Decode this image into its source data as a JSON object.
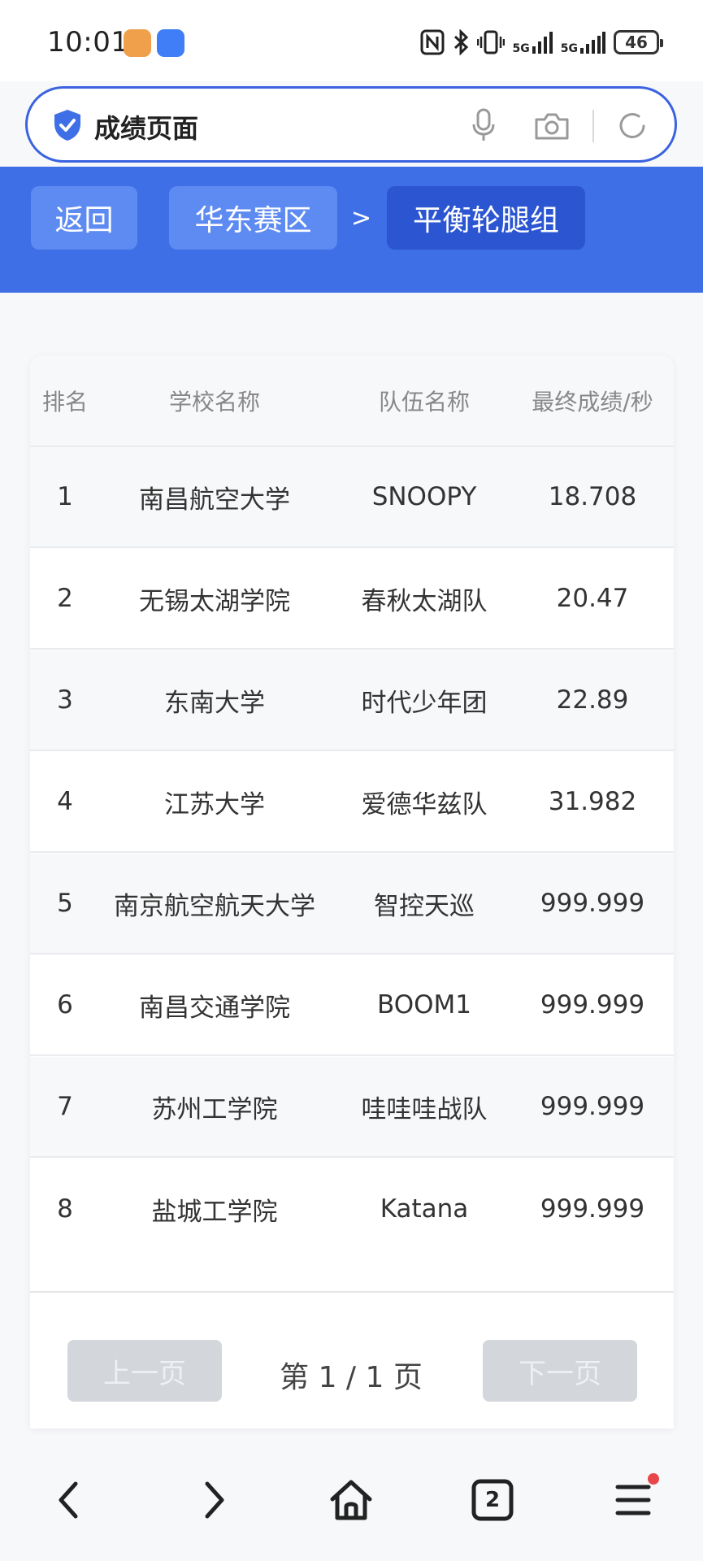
{
  "status_bar": {
    "time": "10:01",
    "net_1": "5G",
    "net_2": "5G",
    "battery": "46",
    "icons": [
      "nfc-icon",
      "bluetooth-icon",
      "vibrate-icon",
      "signal-icon",
      "battery-icon"
    ]
  },
  "address_bar": {
    "text": "成绩页面"
  },
  "breadcrumb": {
    "back": "返回",
    "region": "华东赛区",
    "separator": ">",
    "group": "平衡轮腿组"
  },
  "table": {
    "headers": {
      "rank": "排名",
      "school": "学校名称",
      "team": "队伍名称",
      "score": "最终成绩/秒"
    },
    "rows": [
      {
        "rank": "1",
        "school": "南昌航空大学",
        "team": "SNOOPY",
        "score": "18.708"
      },
      {
        "rank": "2",
        "school": "无锡太湖学院",
        "team": "春秋太湖队",
        "score": "20.47"
      },
      {
        "rank": "3",
        "school": "东南大学",
        "team": "时代少年团",
        "score": "22.89"
      },
      {
        "rank": "4",
        "school": "江苏大学",
        "team": "爱德华兹队",
        "score": "31.982"
      },
      {
        "rank": "5",
        "school": "南京航空航天大学",
        "team": "智控天巡",
        "score": "999.999"
      },
      {
        "rank": "6",
        "school": "南昌交通学院",
        "team": "BOOM1",
        "score": "999.999"
      },
      {
        "rank": "7",
        "school": "苏州工学院",
        "team": "哇哇哇战队",
        "score": "999.999"
      },
      {
        "rank": "8",
        "school": "盐城工学院",
        "team": "Katana",
        "score": "999.999"
      }
    ]
  },
  "pagination": {
    "prev": "上一页",
    "info": "第 1 / 1 页",
    "next": "下一页"
  },
  "bottom_nav": {
    "tabs_count": "2"
  },
  "colors": {
    "brand_blue": "#3e6fe6",
    "active_crumb": "#2b55d1",
    "disabled_button": "#d3d6db"
  }
}
